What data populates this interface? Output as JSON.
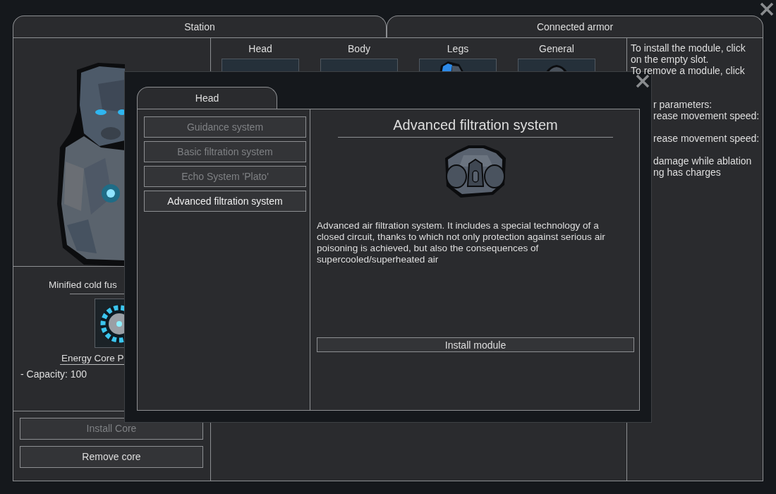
{
  "station": {
    "title": "Station",
    "core": {
      "name": "Minified cold fus",
      "item": "Energy Core P",
      "stats": [
        "- Capacity: 100"
      ]
    },
    "buttons": [
      {
        "label": "Install Core",
        "disabled": true
      },
      {
        "label": "Remove core",
        "disabled": false
      }
    ]
  },
  "armor": {
    "title": "Connected armor",
    "slots": [
      {
        "label": "Head",
        "kind": "empty"
      },
      {
        "label": "Body",
        "kind": "empty"
      },
      {
        "label": "Legs",
        "kind": "legs"
      },
      {
        "label": "General",
        "kind": "general"
      }
    ],
    "help": [
      {
        "lines": [
          "To install the module, click",
          "on the empty slot.",
          "To remove a module, click"
        ]
      },
      {
        "lines": [
          "r parameters:",
          "rease movement speed:"
        ]
      },
      {
        "lines": [
          "rease movement speed:"
        ]
      },
      {
        "lines": [
          "damage while ablation",
          "ng has charges"
        ]
      }
    ]
  },
  "modal": {
    "tab": "Head",
    "modules": [
      {
        "label": "Guidance system",
        "selected": false
      },
      {
        "label": "Basic filtration system",
        "selected": false
      },
      {
        "label": "Echo System 'Plato'",
        "selected": false
      },
      {
        "label": "Advanced filtration system",
        "selected": true
      }
    ],
    "detail": {
      "title": "Advanced filtration system",
      "description": "Advanced air filtration system. It includes a special technology of a closed circuit, thanks to which not only protection against serious air poisoning is achieved, but also the consequences of supercooled/superheated air",
      "button": {
        "label": "Install module",
        "disabled": false
      }
    }
  }
}
